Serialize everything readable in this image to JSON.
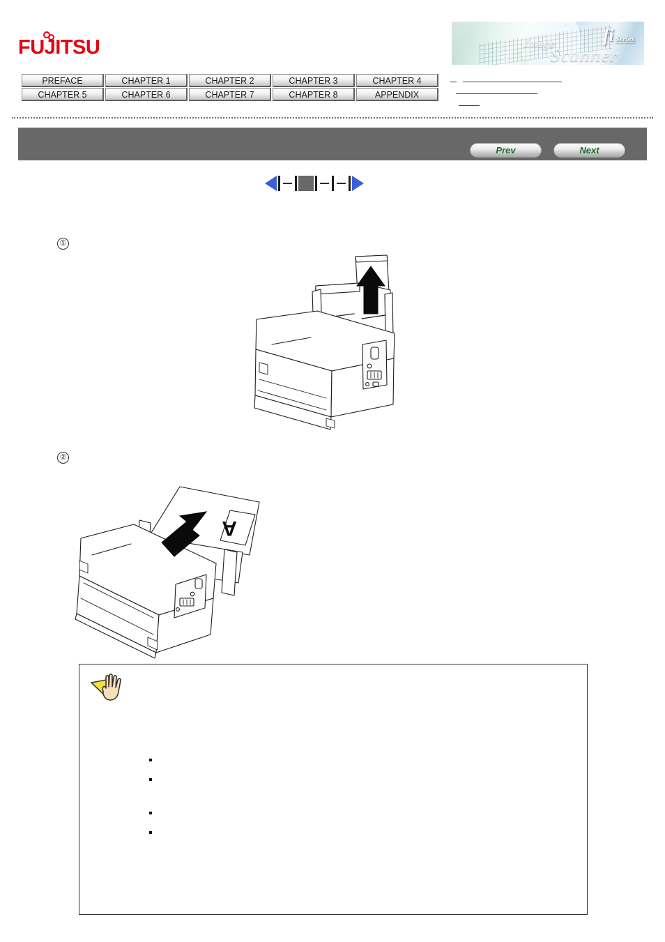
{
  "page": {
    "title": "fi Series Image Scanner — Loading Documents"
  },
  "header": {
    "brand": "FUJITSU",
    "banner": {
      "product_mark": "fi",
      "series_label": "Series",
      "line1": "Image",
      "line2": "Scanner"
    }
  },
  "chapter_tabs": {
    "row1": [
      {
        "label": "PREFACE"
      },
      {
        "label": "CHAPTER 1"
      },
      {
        "label": "CHAPTER 2"
      },
      {
        "label": "CHAPTER 3"
      },
      {
        "label": "CHAPTER 4"
      }
    ],
    "row2": [
      {
        "label": "CHAPTER 5"
      },
      {
        "label": "CHAPTER 6"
      },
      {
        "label": "CHAPTER 7"
      },
      {
        "label": "CHAPTER 8"
      },
      {
        "label": "APPENDIX"
      }
    ]
  },
  "toolbar": {
    "prev_label": "Prev",
    "next_label": "Next"
  },
  "pagination": {
    "first_icon": "triangle-left-icon",
    "last_icon": "triangle-right-icon",
    "current_marker": "current-page-block"
  },
  "steps": [
    {
      "marker": "①",
      "figure_name": "scanner-extend-chute-diagram",
      "figure_caption": ""
    },
    {
      "marker": "②",
      "figure_name": "scanner-load-document-diagram",
      "figure_caption": ""
    }
  ],
  "note": {
    "icon": "attention-hand-icon",
    "intro": "",
    "bullets": [
      {
        "text": ""
      },
      {
        "text": ""
      },
      {
        "text": ""
      },
      {
        "text": ""
      }
    ]
  },
  "colors": {
    "brand_red": "#e60012",
    "toolbar_gray": "#686868",
    "nav_green": "#1d6b2c",
    "pagination_blue": "#3b5fd8",
    "note_icon_yellow": "#f5e03c"
  }
}
